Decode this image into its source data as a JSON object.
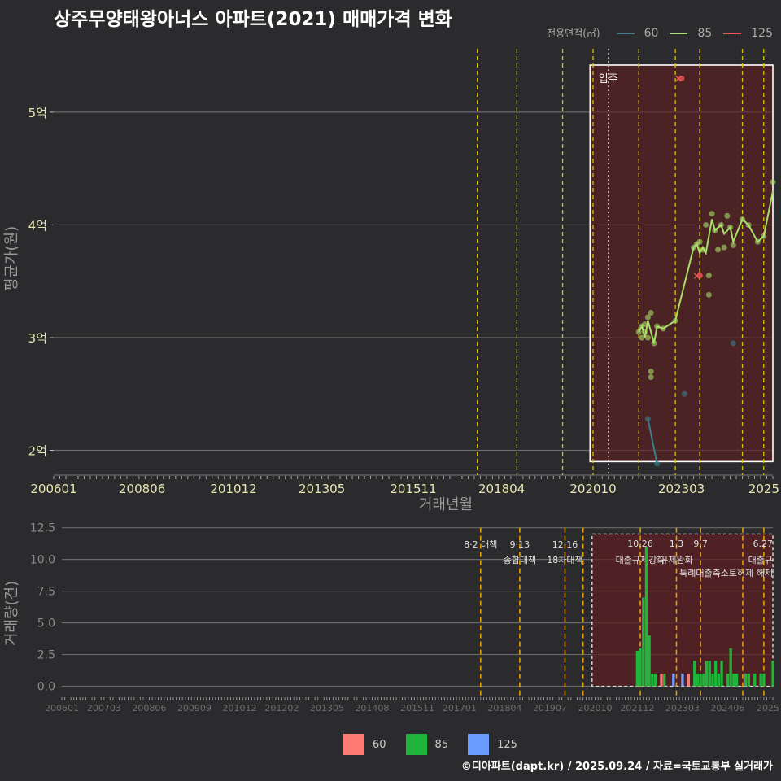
{
  "title": "상주무양태왕아너스 아파트(2021) 매매가격 변화",
  "legend": {
    "title": "전용면적(㎡)",
    "items": [
      {
        "label": "60",
        "line_color": "#3a7f8a",
        "bar_color": "#ff7a72"
      },
      {
        "label": "85",
        "line_color": "#a8e06a",
        "bar_color": "#1fb43a"
      },
      {
        "label": "125",
        "line_color": "#ee5555",
        "bar_color": "#6b9cff"
      }
    ]
  },
  "credit": "©디아파트(dapt.kr) / 2025.09.24 / 자료=국토교통부 실거래가",
  "chart_data": [
    {
      "type": "line",
      "xlabel": "거래년월",
      "ylabel": "평균가(원)",
      "y_ticks": [
        {
          "value": 2,
          "label": "2억"
        },
        {
          "value": 3,
          "label": "3억"
        },
        {
          "value": 4,
          "label": "4억"
        },
        {
          "value": 5,
          "label": "5억"
        }
      ],
      "ylim": [
        1.78,
        5.62
      ],
      "x_ticks": [
        "200601",
        "200806",
        "201012",
        "201305",
        "201511",
        "201804",
        "202010",
        "202303",
        "2025"
      ],
      "policy_lines": [
        "2017-08",
        "2018-09",
        "2019-12",
        "2020-10",
        "2022-01",
        "2023-01",
        "2023-09",
        "2024-11",
        "2025-06"
      ],
      "move_in": {
        "label": "입주",
        "date": "2021-03"
      },
      "highlight": {
        "start": "2020-09",
        "end": "2025-09"
      },
      "series": [
        {
          "name": "60",
          "color": "#3a7f8a",
          "points": [
            [
              "2022-04",
              2.28
            ],
            [
              "2022-07",
              1.88
            ]
          ],
          "scatter": [
            [
              "2022-04",
              2.28
            ],
            [
              "2022-07",
              1.88
            ],
            [
              "2023-04",
              2.5
            ],
            [
              "2024-08",
              2.95
            ]
          ]
        },
        {
          "name": "85",
          "color": "#a8e06a",
          "points": [
            [
              "2022-01",
              3.05
            ],
            [
              "2022-02",
              3.1
            ],
            [
              "2022-03",
              3.0
            ],
            [
              "2022-04",
              3.15
            ],
            [
              "2022-05",
              3.05
            ],
            [
              "2022-06",
              2.95
            ],
            [
              "2022-07",
              3.1
            ],
            [
              "2022-09",
              3.08
            ],
            [
              "2023-01",
              3.15
            ],
            [
              "2023-07",
              3.8
            ],
            [
              "2023-08",
              3.83
            ],
            [
              "2023-09",
              3.75
            ],
            [
              "2023-10",
              3.8
            ],
            [
              "2023-11",
              3.75
            ],
            [
              "2024-01",
              4.05
            ],
            [
              "2024-02",
              3.95
            ],
            [
              "2024-04",
              4.0
            ],
            [
              "2024-05",
              3.92
            ],
            [
              "2024-07",
              3.98
            ],
            [
              "2024-08",
              3.85
            ],
            [
              "2024-11",
              4.05
            ],
            [
              "2025-01",
              4.0
            ],
            [
              "2025-04",
              3.85
            ],
            [
              "2025-06",
              3.9
            ],
            [
              "2025-09",
              4.3
            ]
          ],
          "scatter": [
            [
              "2022-01",
              3.05
            ],
            [
              "2022-02",
              3.1
            ],
            [
              "2022-02",
              3.0
            ],
            [
              "2022-03",
              3.05
            ],
            [
              "2022-03",
              3.12
            ],
            [
              "2022-04",
              3.18
            ],
            [
              "2022-04",
              3.0
            ],
            [
              "2022-05",
              3.22
            ],
            [
              "2022-05",
              2.7
            ],
            [
              "2022-05",
              2.65
            ],
            [
              "2022-06",
              2.95
            ],
            [
              "2022-07",
              3.1
            ],
            [
              "2022-09",
              3.08
            ],
            [
              "2023-01",
              3.15
            ],
            [
              "2023-07",
              3.8
            ],
            [
              "2023-08",
              3.83
            ],
            [
              "2023-09",
              3.85
            ],
            [
              "2023-10",
              3.78
            ],
            [
              "2023-11",
              4.0
            ],
            [
              "2023-12",
              3.55
            ],
            [
              "2023-12",
              3.38
            ],
            [
              "2024-01",
              4.1
            ],
            [
              "2024-02",
              3.95
            ],
            [
              "2024-03",
              3.78
            ],
            [
              "2024-04",
              4.0
            ],
            [
              "2024-05",
              3.8
            ],
            [
              "2024-06",
              4.08
            ],
            [
              "2024-07",
              3.98
            ],
            [
              "2024-08",
              3.82
            ],
            [
              "2024-11",
              4.05
            ],
            [
              "2025-01",
              4.0
            ],
            [
              "2025-04",
              3.85
            ],
            [
              "2025-06",
              3.9
            ],
            [
              "2025-09",
              4.38
            ]
          ]
        },
        {
          "name": "125",
          "color": "#ee5555",
          "points": [],
          "scatter": [
            [
              "2023-02",
              5.3
            ],
            [
              "2023-08",
              3.55
            ]
          ]
        }
      ]
    },
    {
      "type": "bar",
      "xlabel": "",
      "ylabel": "거래량(건)",
      "y_ticks": [
        {
          "value": 0,
          "label": "0.0"
        },
        {
          "value": 2.5,
          "label": "2.5"
        },
        {
          "value": 5,
          "label": "5.0"
        },
        {
          "value": 7.5,
          "label": "7.5"
        },
        {
          "value": 10,
          "label": "10.0"
        },
        {
          "value": 12.5,
          "label": "12.5"
        }
      ],
      "ylim": [
        -0.8,
        12.8
      ],
      "x_ticks": [
        "200601",
        "200703",
        "200806",
        "200909",
        "201012",
        "201202",
        "201305",
        "201408",
        "201511",
        "201701",
        "201804",
        "201907",
        "202010",
        "202112",
        "202303",
        "202406",
        "2025"
      ],
      "highlight": {
        "start": "2020-09",
        "end": "2025-09"
      },
      "policies": [
        {
          "date": "2017-08",
          "label1": "8·2 대책",
          "label2": ""
        },
        {
          "date": "2018-09",
          "label1": "9·13",
          "label2": "종합대책"
        },
        {
          "date": "2019-12",
          "label1": "12·16",
          "label2": "18차대책"
        },
        {
          "date": "2020-06",
          "label1": "",
          "label2": ""
        },
        {
          "date": "2022-01",
          "label1": "10.26",
          "label2": "대출규제강화"
        },
        {
          "date": "2023-01",
          "label1": "1.3",
          "label2": "규제완화"
        },
        {
          "date": "2023-09",
          "label1": "9.7",
          "label2": ""
        },
        {
          "date": "2024-11",
          "label1": "",
          "label2": ""
        },
        {
          "date": "2025-06",
          "label1": "6.27",
          "label2": "대출규"
        }
      ],
      "policy_note": "특례대출축소토허제 해제",
      "series": [
        {
          "name": "60",
          "color": "#ff7a72",
          "bars": [
            [
              "2022-08",
              1
            ],
            [
              "2023-05",
              1
            ]
          ]
        },
        {
          "name": "85",
          "color": "#1fb43a",
          "bars": [
            [
              "2021-12",
              2.8
            ],
            [
              "2022-01",
              3
            ],
            [
              "2022-02",
              7
            ],
            [
              "2022-03",
              11
            ],
            [
              "2022-04",
              4
            ],
            [
              "2022-05",
              1
            ],
            [
              "2022-06",
              1
            ],
            [
              "2022-09",
              1
            ],
            [
              "2023-07",
              2
            ],
            [
              "2023-08",
              1
            ],
            [
              "2023-09",
              1
            ],
            [
              "2023-10",
              1
            ],
            [
              "2023-11",
              2
            ],
            [
              "2023-12",
              2
            ],
            [
              "2024-01",
              1
            ],
            [
              "2024-02",
              2
            ],
            [
              "2024-03",
              1
            ],
            [
              "2024-04",
              2
            ],
            [
              "2024-06",
              1
            ],
            [
              "2024-07",
              3
            ],
            [
              "2024-08",
              1
            ],
            [
              "2024-09",
              1
            ],
            [
              "2024-12",
              1
            ],
            [
              "2025-01",
              1
            ],
            [
              "2025-03",
              1
            ],
            [
              "2025-05",
              1
            ],
            [
              "2025-06",
              1
            ],
            [
              "2025-09",
              2
            ]
          ]
        },
        {
          "name": "125",
          "color": "#6b9cff",
          "bars": [
            [
              "2022-12",
              1
            ],
            [
              "2023-03",
              1
            ]
          ]
        }
      ]
    }
  ]
}
